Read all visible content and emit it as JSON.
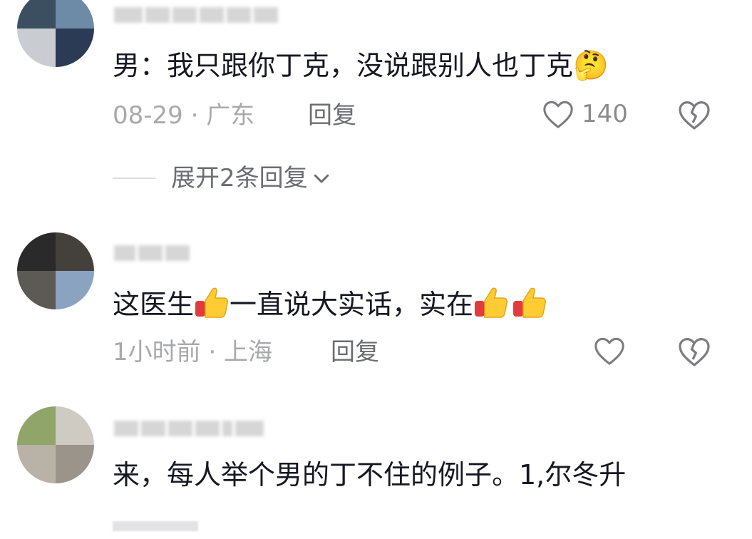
{
  "comments": [
    {
      "text": "男：我只跟你丁克，没说跟别人也丁克",
      "emoji": "🤔",
      "meta": "08-29 · 广东",
      "reply_label": "回复",
      "like_count": "140",
      "expand_label": "展开2条回复"
    },
    {
      "text_parts": [
        "这医生",
        "一直说大实话，实在"
      ],
      "meta": "1小时前 · 上海",
      "reply_label": "回复"
    },
    {
      "text": "来，每人举个男的丁不住的例子。1,尔冬升"
    }
  ],
  "icons": {
    "like": "heart-outline-icon",
    "dislike": "broken-heart-icon",
    "expand": "chevron-down-icon",
    "thumbs": "thumbs-up-emoji"
  },
  "colors": {
    "text": "#161823",
    "meta": "#a8a9ad",
    "reply": "#6b6d72",
    "icon": "#7b7c80"
  }
}
